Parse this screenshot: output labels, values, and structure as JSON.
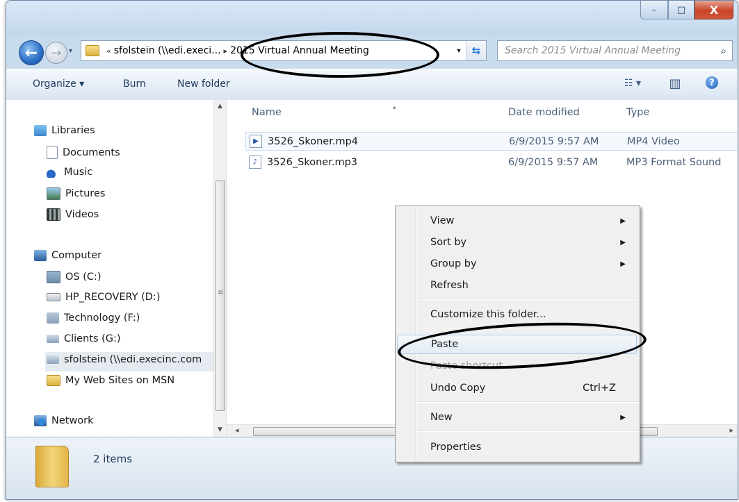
{
  "window": {
    "caption_buttons": {
      "minimize": "–",
      "maximize": "□",
      "close": "X"
    }
  },
  "nav": {
    "back_glyph": "←",
    "forward_glyph": "→",
    "history_glyph": "▾"
  },
  "address": {
    "overflow": "«",
    "crumbs": [
      "sfolstein (\\\\edi.execi...",
      "2015 Virtual Annual Meeting"
    ],
    "separator": "▸",
    "dropdown_glyph": "▾",
    "refresh_glyph": "⇆"
  },
  "search": {
    "placeholder": "Search 2015 Virtual Annual Meeting",
    "icon": "search-icon",
    "glyph": "⌕"
  },
  "toolbar": {
    "organize": "Organize ▾",
    "burn": "Burn",
    "new_folder": "New folder",
    "views_glyph": "☷ ▾",
    "preview_glyph": "▥",
    "help_glyph": "?"
  },
  "navpane": {
    "items": [
      {
        "label": "Libraries",
        "icon": "libraries-icon"
      },
      {
        "label": "Documents",
        "icon": "documents-icon"
      },
      {
        "label": "Music",
        "icon": "music-icon"
      },
      {
        "label": "Pictures",
        "icon": "pictures-icon"
      },
      {
        "label": "Videos",
        "icon": "videos-icon"
      },
      {
        "label": "Computer",
        "icon": "computer-icon"
      },
      {
        "label": "OS (C:)",
        "icon": "os-drive-icon"
      },
      {
        "label": "HP_RECOVERY (D:)",
        "icon": "drive-icon"
      },
      {
        "label": "Technology (F:)",
        "icon": "disconnected-drive-icon"
      },
      {
        "label": "Clients (G:)",
        "icon": "network-drive-icon"
      },
      {
        "label": "sfolstein (\\\\edi.execinc.com",
        "icon": "network-drive-icon"
      },
      {
        "label": "My Web Sites on MSN",
        "icon": "folder-icon"
      },
      {
        "label": "Network",
        "icon": "network-icon"
      }
    ],
    "scroll_up": "▲",
    "scroll_down": "▼",
    "grip": "≡"
  },
  "filelist": {
    "columns": {
      "name": "Name",
      "date": "Date modified",
      "type": "Type"
    },
    "sort_glyph": "▴",
    "rows": [
      {
        "name": "3526_Skoner.mp4",
        "date": "6/9/2015 9:57 AM",
        "type": "MP4 Video",
        "icon": "video-file-icon",
        "glyph": "▶"
      },
      {
        "name": "3526_Skoner.mp3",
        "date": "6/9/2015 9:57 AM",
        "type": "MP3 Format Sound",
        "icon": "audio-file-icon",
        "glyph": "♪"
      }
    ],
    "hscroll_left": "◂",
    "hscroll_right": "▸"
  },
  "status": {
    "count": "2 items"
  },
  "context_menu": {
    "submenu_glyph": "▶",
    "items": [
      {
        "label": "View",
        "submenu": true
      },
      {
        "label": "Sort by",
        "submenu": true
      },
      {
        "label": "Group by",
        "submenu": true
      },
      {
        "label": "Refresh"
      },
      {
        "label": "Customize this folder..."
      },
      {
        "label": "Paste"
      },
      {
        "label": "Paste shortcut"
      },
      {
        "label": "Undo Copy",
        "shortcut": "Ctrl+Z"
      },
      {
        "label": "New",
        "submenu": true
      },
      {
        "label": "Properties"
      }
    ]
  },
  "annotations": {
    "color": "#000000"
  }
}
